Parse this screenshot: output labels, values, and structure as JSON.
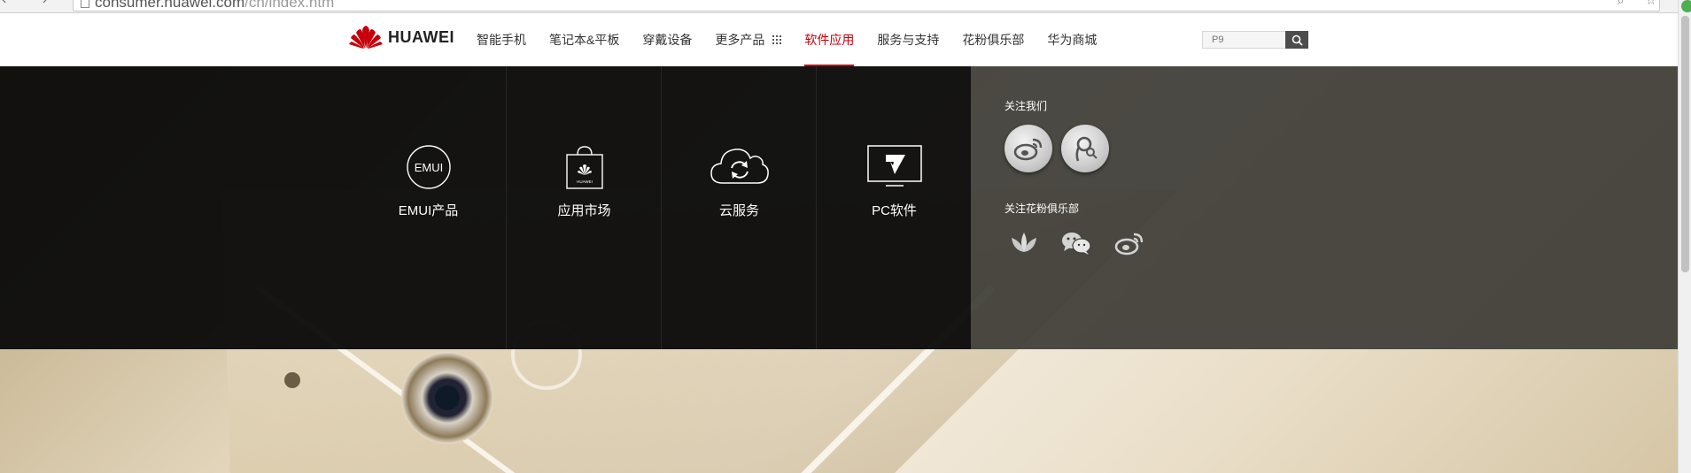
{
  "browser": {
    "url_host": "consumer.huawei.com",
    "url_path": "/cn/index.htm"
  },
  "header": {
    "brand": "HUAWEI",
    "nav": [
      {
        "label": "智能手机",
        "active": false
      },
      {
        "label": "笔记本&平板",
        "active": false
      },
      {
        "label": "穿戴设备",
        "active": false
      },
      {
        "label": "更多产品",
        "active": false,
        "icon": "grid-icon"
      },
      {
        "label": "软件应用",
        "active": true
      },
      {
        "label": "服务与支持",
        "active": false
      },
      {
        "label": "花粉俱乐部",
        "active": false
      },
      {
        "label": "华为商城",
        "active": false
      }
    ],
    "search": {
      "placeholder": "P9"
    }
  },
  "dropdown": {
    "items": [
      {
        "label": "EMUI产品",
        "icon": "emui-icon",
        "icon_text": "EMUI"
      },
      {
        "label": "应用市场",
        "icon": "app-market-bag-icon",
        "icon_text": "HUAWEI"
      },
      {
        "label": "云服务",
        "icon": "cloud-sync-icon"
      },
      {
        "label": "PC软件",
        "icon": "pc-monitor-icon"
      }
    ],
    "follow_us": {
      "title": "关注我们",
      "icons": [
        "weibo-icon",
        "tencent-weibo-icon"
      ]
    },
    "follow_club": {
      "title": "关注花粉俱乐部",
      "icons": [
        "lotus-icon",
        "wechat-icon",
        "weibo-icon"
      ]
    }
  },
  "colors": {
    "brand_red": "#c7000b",
    "dropdown_dark": "#080808",
    "dropdown_gray": "#3e3c37"
  }
}
